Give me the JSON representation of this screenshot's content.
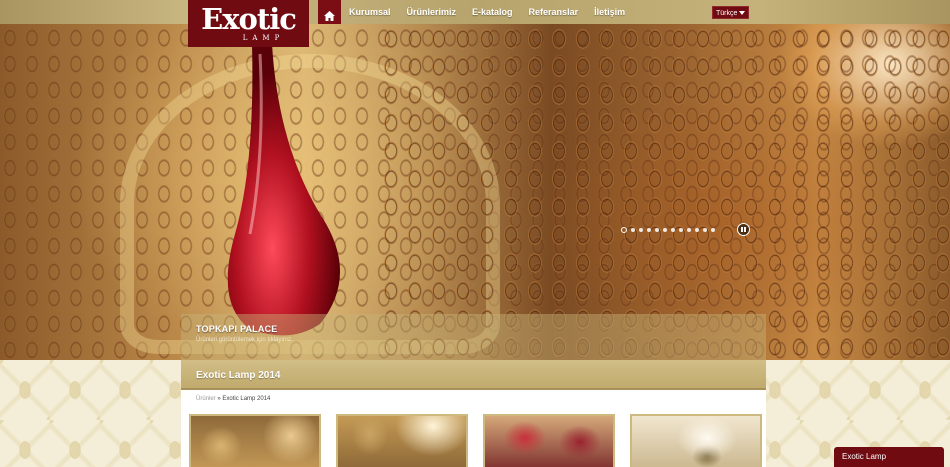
{
  "logo": {
    "main": "Exotic",
    "sub": "LAMP"
  },
  "nav": {
    "home_icon": "home-icon",
    "items": [
      {
        "label": "Kurumsal"
      },
      {
        "label": "Ürünlerimiz"
      },
      {
        "label": "E-katalog"
      },
      {
        "label": "Referanslar"
      },
      {
        "label": "İletişim"
      }
    ]
  },
  "language": {
    "selected": "Türkçe"
  },
  "slider": {
    "caption_title": "TOPKAPI PALACE",
    "caption_subtitle": "Ürünleri görüntülemek için tıklayınız.",
    "dot_count": 12,
    "active_dot": 0,
    "pause_icon": "pause-icon"
  },
  "section": {
    "title": "Exotic Lamp 2014"
  },
  "breadcrumb": {
    "parent": "Ürünler",
    "separator": " » ",
    "current": "Exotic Lamp 2014"
  },
  "products": [
    {
      "name": "product-1"
    },
    {
      "name": "product-2"
    },
    {
      "name": "product-3"
    },
    {
      "name": "product-4"
    }
  ],
  "chat": {
    "label": "Exotic Lamp"
  },
  "colors": {
    "brand": "#6f0b11",
    "gold": "#c0aa6d",
    "header": "#b7a36c"
  }
}
